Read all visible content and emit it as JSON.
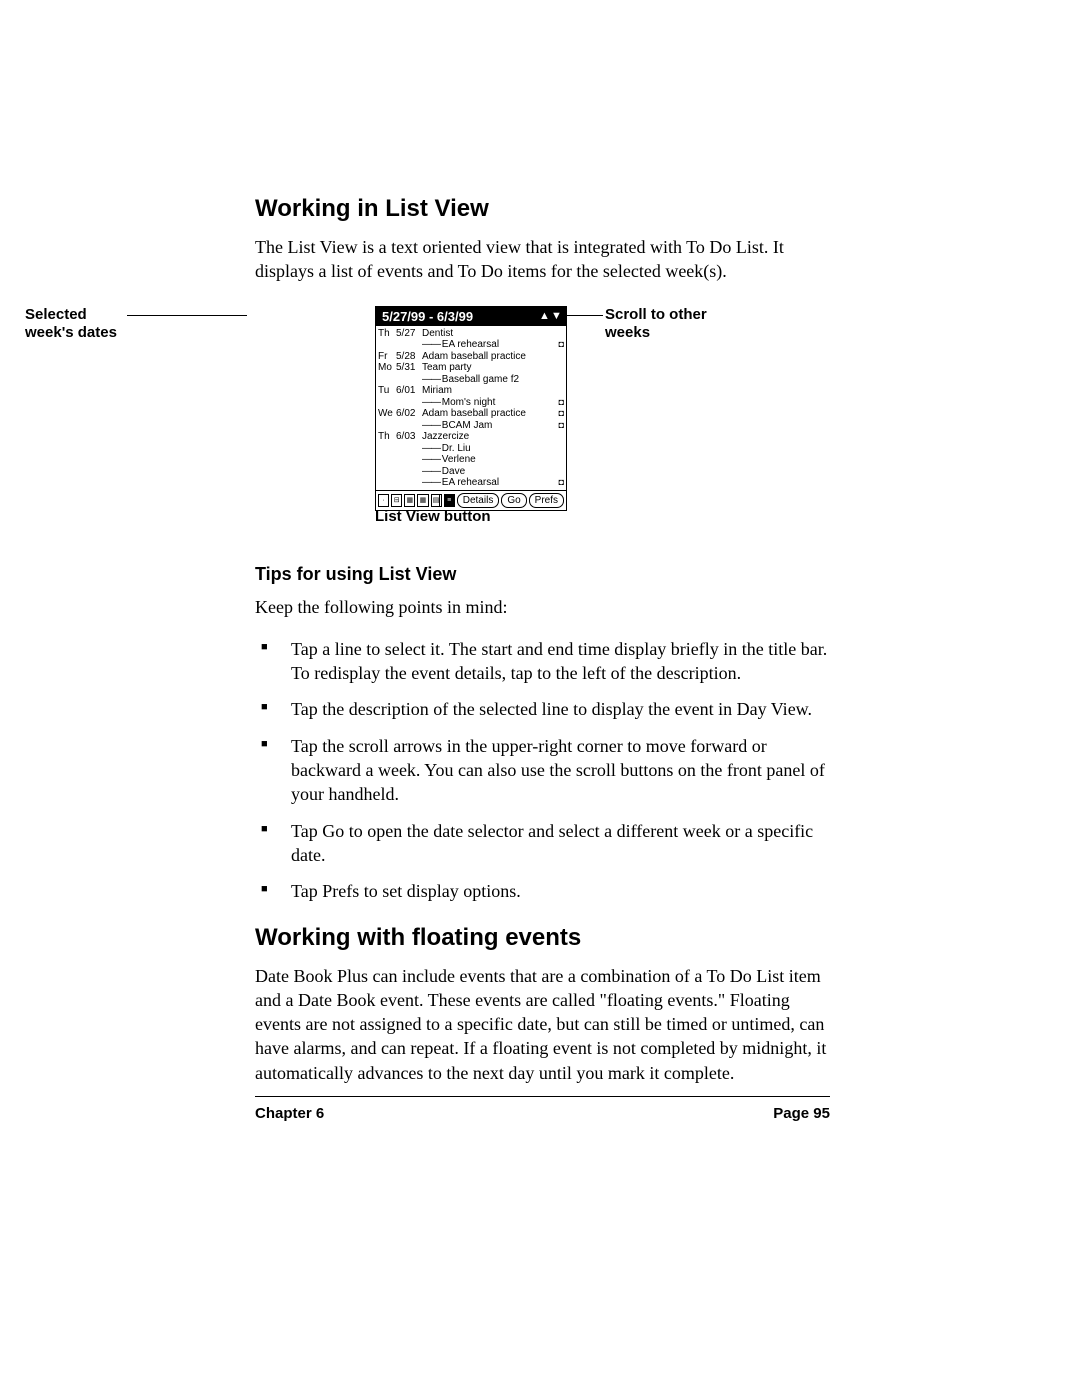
{
  "section1_title": "Working in List View",
  "section1_para": "The List View is a text oriented view that is integrated with To Do List. It displays a list of events and To Do items for the selected week(s).",
  "callout_left": "Selected week's dates",
  "callout_right": "Scroll to other weeks",
  "device": {
    "title": "5/27/99 - 6/3/99",
    "rows": [
      {
        "day": "Th",
        "date": "5/27",
        "text": "Dentist",
        "icon": ""
      },
      {
        "sub": true,
        "text": "EA rehearsal",
        "icon": "◘"
      },
      {
        "day": "Fr",
        "date": "5/28",
        "text": "Adam baseball practice",
        "icon": ""
      },
      {
        "day": "Mo",
        "date": "5/31",
        "text": "Team party",
        "icon": ""
      },
      {
        "sub": true,
        "text": "Baseball game f2",
        "icon": ""
      },
      {
        "day": "Tu",
        "date": "6/01",
        "text": "Miriam",
        "icon": ""
      },
      {
        "sub": true,
        "text": "Mom's night",
        "icon": "◘"
      },
      {
        "day": "We",
        "date": "6/02",
        "text": "Adam baseball practice",
        "icon": "◘"
      },
      {
        "sub": true,
        "text": "BCAM Jam",
        "icon": "◘"
      },
      {
        "day": "Th",
        "date": "6/03",
        "text": "Jazzercize",
        "icon": ""
      },
      {
        "sub": true,
        "text": "Dr. Liu",
        "icon": ""
      },
      {
        "sub": true,
        "text": "Verlene",
        "icon": ""
      },
      {
        "sub": true,
        "text": "Dave",
        "icon": ""
      },
      {
        "sub": true,
        "text": "EA rehearsal",
        "icon": "◘"
      }
    ],
    "buttons": {
      "details": "Details",
      "go": "Go",
      "prefs": "Prefs"
    }
  },
  "list_caption": "List View button",
  "tips_heading": "Tips for using List View",
  "tips_intro": "Keep the following points in mind:",
  "tips": [
    "Tap a line to select it. The start and end time display briefly in the title bar. To redisplay the event details, tap to the left of the description.",
    "Tap the description of the selected line to display the event in Day View.",
    "Tap the scroll arrows in the upper-right corner to move forward or backward a week. You can also use the scroll buttons on the front panel of your handheld.",
    "Tap Go to open the date selector and select a different week or a specific date.",
    "Tap Prefs to set display options."
  ],
  "section2_title": "Working with floating events",
  "section2_para": "Date Book Plus can include events that are a combination of a To Do List item and a Date Book event. These events are called \"floating events.\" Floating events are not assigned to a specific date, but can still be timed or untimed, can have alarms, and can repeat. If a floating event is not completed by midnight, it automatically advances to the next day until you mark it complete.",
  "footer_left": "Chapter 6",
  "footer_right": "Page 95"
}
